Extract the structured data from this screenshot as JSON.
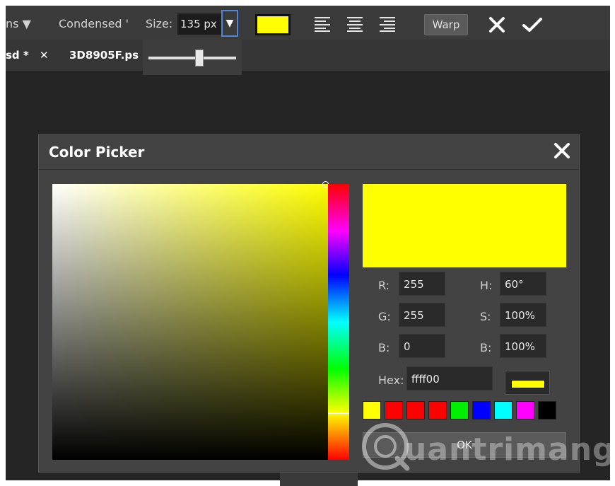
{
  "toolbar": {
    "options_label": "ns ▼",
    "font_style": "Condensed '",
    "size_label": "Size:",
    "size_value": "135 px",
    "size_dropdown_glyph": "▼",
    "text_color": "#ffff00",
    "align_icons": [
      "align-left-icon",
      "align-center-icon",
      "align-right-icon"
    ],
    "warp_label": "Warp",
    "cancel_icon": "close-icon",
    "commit_icon": "check-icon"
  },
  "tabs": [
    {
      "label": "sd *",
      "close": "✕"
    },
    {
      "label": "3D8905F.ps"
    }
  ],
  "size_slider": {
    "value_fraction": 0.6
  },
  "dialog": {
    "title": "Color Picker",
    "close_icon": "close-icon",
    "current_color": "#ffff00",
    "rgb": {
      "r_label": "R:",
      "r": "255",
      "g_label": "G:",
      "g": "255",
      "b_label": "B:",
      "b": "0"
    },
    "hsb": {
      "h_label": "H:",
      "h": "60°",
      "s_label": "S:",
      "s": "100%",
      "b_label": "B:",
      "b": "100%"
    },
    "hex_label": "Hex:",
    "hex_value": "ffff00",
    "palette": [
      "#ffff00",
      "#ff0000",
      "#ff0000",
      "#ff0000",
      "#00ee00",
      "#0000ff",
      "#00ffff",
      "#ff00ff",
      "#000000"
    ],
    "ok_label": "OK"
  },
  "watermark": "uantrimang"
}
